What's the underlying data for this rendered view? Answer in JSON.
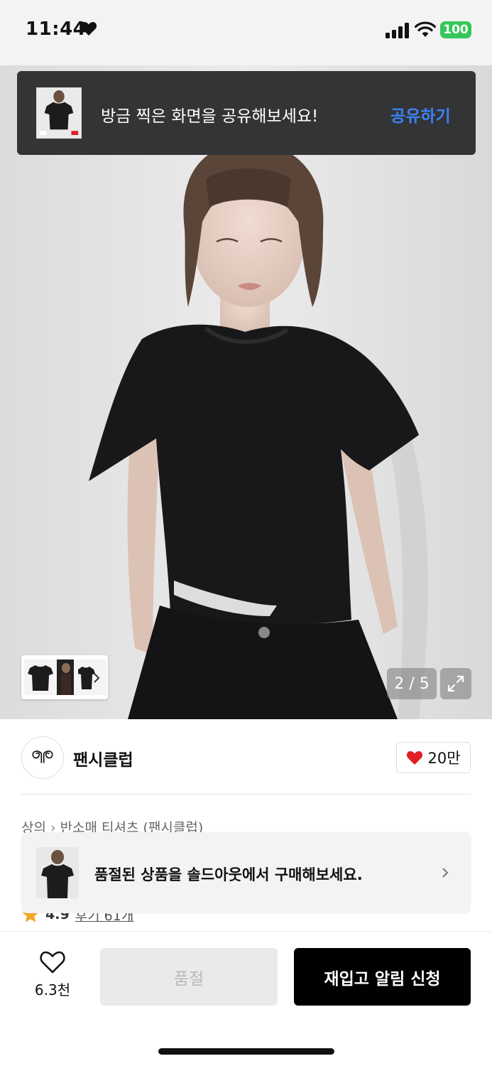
{
  "status_bar": {
    "time": "11:44",
    "battery": "100",
    "icons": [
      "heart-icon",
      "signal-icon",
      "wifi-icon",
      "battery-icon"
    ],
    "battery_color": "#35c759"
  },
  "share_toast": {
    "message": "방금 찍은 화면을 공유해보세요!",
    "action": "공유하기",
    "action_color": "#3b82f6"
  },
  "gallery": {
    "pager": "2 / 5",
    "icons": [
      "chevron-right-icon",
      "expand-icon"
    ]
  },
  "brand": {
    "logo_text": "ꓘ",
    "name": "팬시클럽",
    "likes": "20만",
    "like_color": "#e11d26"
  },
  "breadcrumb": {
    "items": [
      "상의",
      "반소매 티셔츠 (팬시클럽)"
    ]
  },
  "rating": {
    "score": "4.9",
    "reviews": "후기 61개",
    "star_color": "#f5a623"
  },
  "sold_toast": {
    "message": "품절된 상품을 솔드아웃에서 구매해보세요."
  },
  "bottom_bar": {
    "wish_count": "6.3천",
    "soldout_label": "품절",
    "restock_label": "재입고 알림 신청"
  }
}
